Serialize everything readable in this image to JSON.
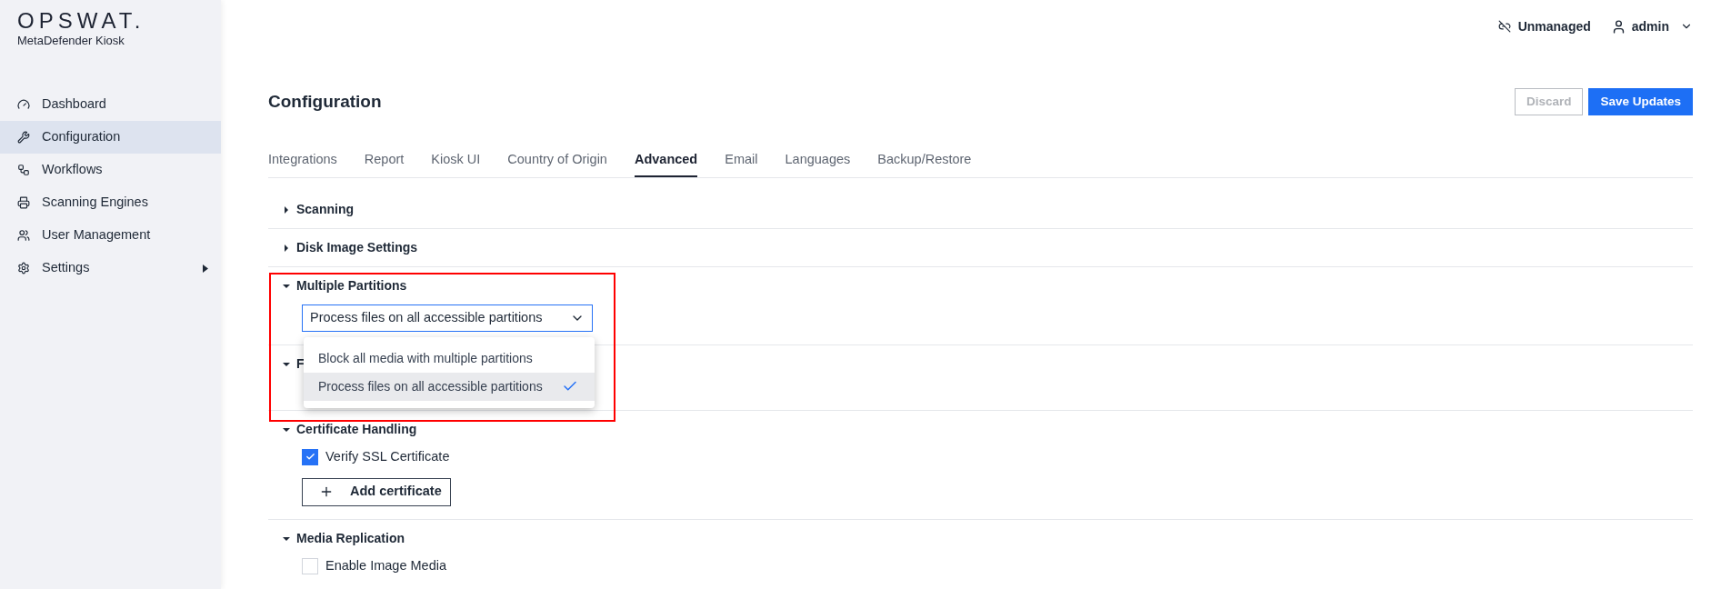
{
  "logo": {
    "brand": "OPSWAT.",
    "product": "MetaDefender Kiosk"
  },
  "sidebar": {
    "items": [
      {
        "label": "Dashboard",
        "selected": false,
        "submenu": false
      },
      {
        "label": "Configuration",
        "selected": true,
        "submenu": false
      },
      {
        "label": "Workflows",
        "selected": false,
        "submenu": false
      },
      {
        "label": "Scanning Engines",
        "selected": false,
        "submenu": false
      },
      {
        "label": "User Management",
        "selected": false,
        "submenu": false
      },
      {
        "label": "Settings",
        "selected": false,
        "submenu": true
      }
    ]
  },
  "header": {
    "status": "Unmanaged",
    "user": "admin"
  },
  "page": {
    "title": "Configuration",
    "buttons": [
      {
        "label": "Discard",
        "kind": "outline",
        "disabled": true
      },
      {
        "label": "Save Updates",
        "kind": "primary",
        "disabled": false
      }
    ]
  },
  "tabs": [
    {
      "label": "Integrations",
      "selected": false
    },
    {
      "label": "Report",
      "selected": false
    },
    {
      "label": "Kiosk UI",
      "selected": false
    },
    {
      "label": "Country of Origin",
      "selected": false
    },
    {
      "label": "Advanced",
      "selected": true
    },
    {
      "label": "Email",
      "selected": false
    },
    {
      "label": "Languages",
      "selected": false
    },
    {
      "label": "Backup/Restore",
      "selected": false
    }
  ],
  "sections": [
    {
      "title": "Scanning",
      "expanded": false
    },
    {
      "title": "Disk Image Settings",
      "expanded": false
    },
    {
      "title": "Multiple Partitions",
      "expanded": true,
      "highlighted": true,
      "controls": [
        {
          "kind": "select",
          "value": "Process files on all accessible partitions",
          "open": true,
          "options": [
            {
              "label": "Block all media with multiple partitions",
              "selected": false
            },
            {
              "label": "Process files on all accessible partitions",
              "selected": true
            }
          ]
        }
      ]
    },
    {
      "title": "F",
      "expanded": true
    },
    {
      "title": "Certificate Handling",
      "expanded": true,
      "controls": [
        {
          "kind": "checkbox",
          "label": "Verify SSL Certificate",
          "checked": true
        },
        {
          "kind": "button",
          "label": "Add certificate"
        }
      ]
    },
    {
      "title": "Media Replication",
      "expanded": true,
      "controls": [
        {
          "kind": "checkbox",
          "label": "Enable Image Media",
          "checked": false
        }
      ]
    }
  ]
}
